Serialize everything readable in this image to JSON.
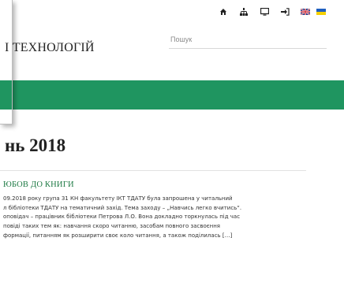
{
  "header": {
    "site_title": "І ТЕХНОЛОГІЙ",
    "search_placeholder": "Пошук"
  },
  "top_icons": [
    "home-icon",
    "sitemap-icon",
    "monitor-icon",
    "login-icon",
    "uk-flag-icon",
    "ua-flag-icon"
  ],
  "colors": {
    "nav_green": "#1f9560",
    "post_title_green": "#1e7a44"
  },
  "main": {
    "heading": "нь 2018",
    "post": {
      "title": "ЮБОВ ДО КНИГИ",
      "lines": [
        "09.2018 року група 31 КН факультету ІКТ ТДАТУ була запрошена у читальний",
        "л бібліотеки ТДАТУ на тематичний захід. Тема заходу – „Навчись легко вчитись“.",
        "оповідач – працівник бібліотеки Петрова Л.О. Вона докладно торкнулась під час",
        "повіді таких тем як: навчання скоро читанню, засобам повного засвоєння",
        "формації, питанням як розширити своє коло читання, а також поділилась […]"
      ]
    }
  }
}
